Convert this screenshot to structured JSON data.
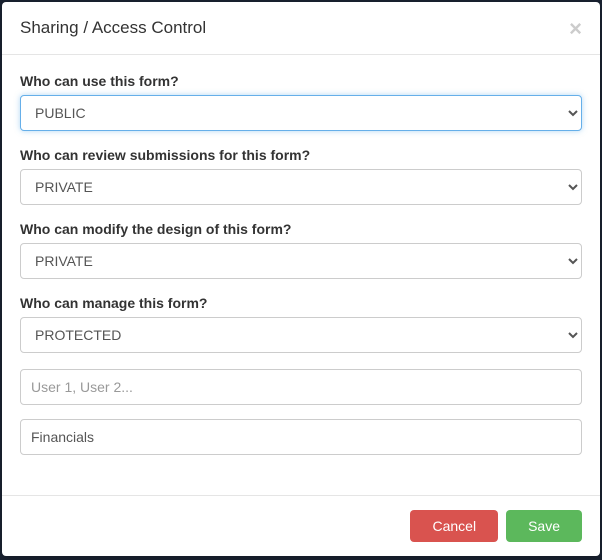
{
  "modal": {
    "title": "Sharing / Access Control",
    "fields": {
      "use": {
        "label": "Who can use this form?",
        "value": "PUBLIC"
      },
      "review": {
        "label": "Who can review submissions for this form?",
        "value": "PRIVATE"
      },
      "modify": {
        "label": "Who can modify the design of this form?",
        "value": "PRIVATE"
      },
      "manage": {
        "label": "Who can manage this form?",
        "value": "PROTECTED"
      },
      "users": {
        "placeholder": "User 1, User 2...",
        "value": ""
      },
      "groups": {
        "value": "Financials"
      }
    },
    "buttons": {
      "cancel": "Cancel",
      "save": "Save"
    }
  }
}
